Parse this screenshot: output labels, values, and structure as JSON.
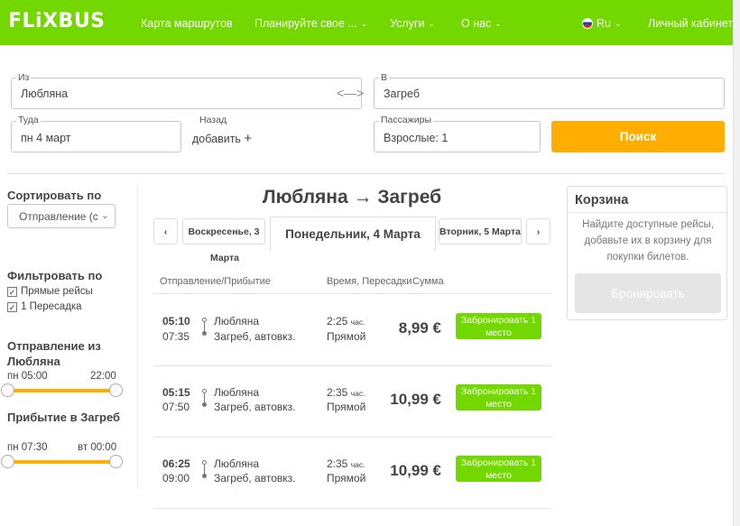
{
  "header": {
    "logo": "FLiXBUS",
    "nav": [
      "Карта маршрутов",
      "Планируйте свое ...",
      "Услуги",
      "О нас"
    ],
    "lang": "Ru",
    "account": "Личный кабинет"
  },
  "search": {
    "from_label": "Из",
    "from_value": "Любляна",
    "to_label": "В",
    "to_value": "Загреб",
    "depart_label": "Туда",
    "depart_value": "пн 4 март",
    "return_label": "Назад",
    "return_value": "добавить",
    "passengers_label": "Пассажиры",
    "passengers_value": "Взрослые: 1",
    "search_button": "Поиск"
  },
  "sidebar": {
    "sort_title": "Сортировать по",
    "sort_value": "Отправление (с",
    "filter_title": "Фильтровать по",
    "filters": [
      "Прямые рейсы",
      "1 Пересадка"
    ],
    "departure_title": "Отправление из Любляна",
    "departure_from": "пн 05:00",
    "departure_to": "22:00",
    "arrival_title": "Прибытие в Загреб",
    "arrival_from": "пн 07:30",
    "arrival_to": "вт 00:00"
  },
  "results": {
    "route_title": "Любляна → Загреб",
    "prev_day": "Воскресенье, 3",
    "current_day": "Понедельник, 4 Марта",
    "current_day_tail": "Марта",
    "next_day": "Вторник, 5 Марта",
    "prev_arrow": "‹",
    "next_arrow": "›",
    "col_route": "Отправление/Прибытие",
    "col_time": "Время, Пересадки",
    "col_price": "Сумма",
    "trips": [
      {
        "dep": "05:10",
        "arr": "07:35",
        "from": "Любляна",
        "to": "Загреб, автовкз.",
        "dur": "2:25",
        "dur_unit": "час.",
        "type": "Прямой",
        "price": "8,99 €",
        "book": "Забронировать 1 место"
      },
      {
        "dep": "05:15",
        "arr": "07:50",
        "from": "Любляна",
        "to": "Загреб, автовкз.",
        "dur": "2:35",
        "dur_unit": "час.",
        "type": "Прямой",
        "price": "10,99 €",
        "book": "Забронировать 1 место"
      },
      {
        "dep": "06:25",
        "arr": "09:00",
        "from": "Любляна",
        "to": "Загреб, автовкз.",
        "dur": "2:35",
        "dur_unit": "час.",
        "type": "Прямой",
        "price": "10,99 €",
        "book": "Забронировать 1 место"
      }
    ]
  },
  "cart": {
    "title": "Корзина",
    "text": "Найдите доступные рейсы, добавьте их в корзину для покупки билетов.",
    "button": "Бронировать"
  },
  "colors": {
    "brand_green": "#73d700",
    "accent_orange": "#ffad00"
  }
}
